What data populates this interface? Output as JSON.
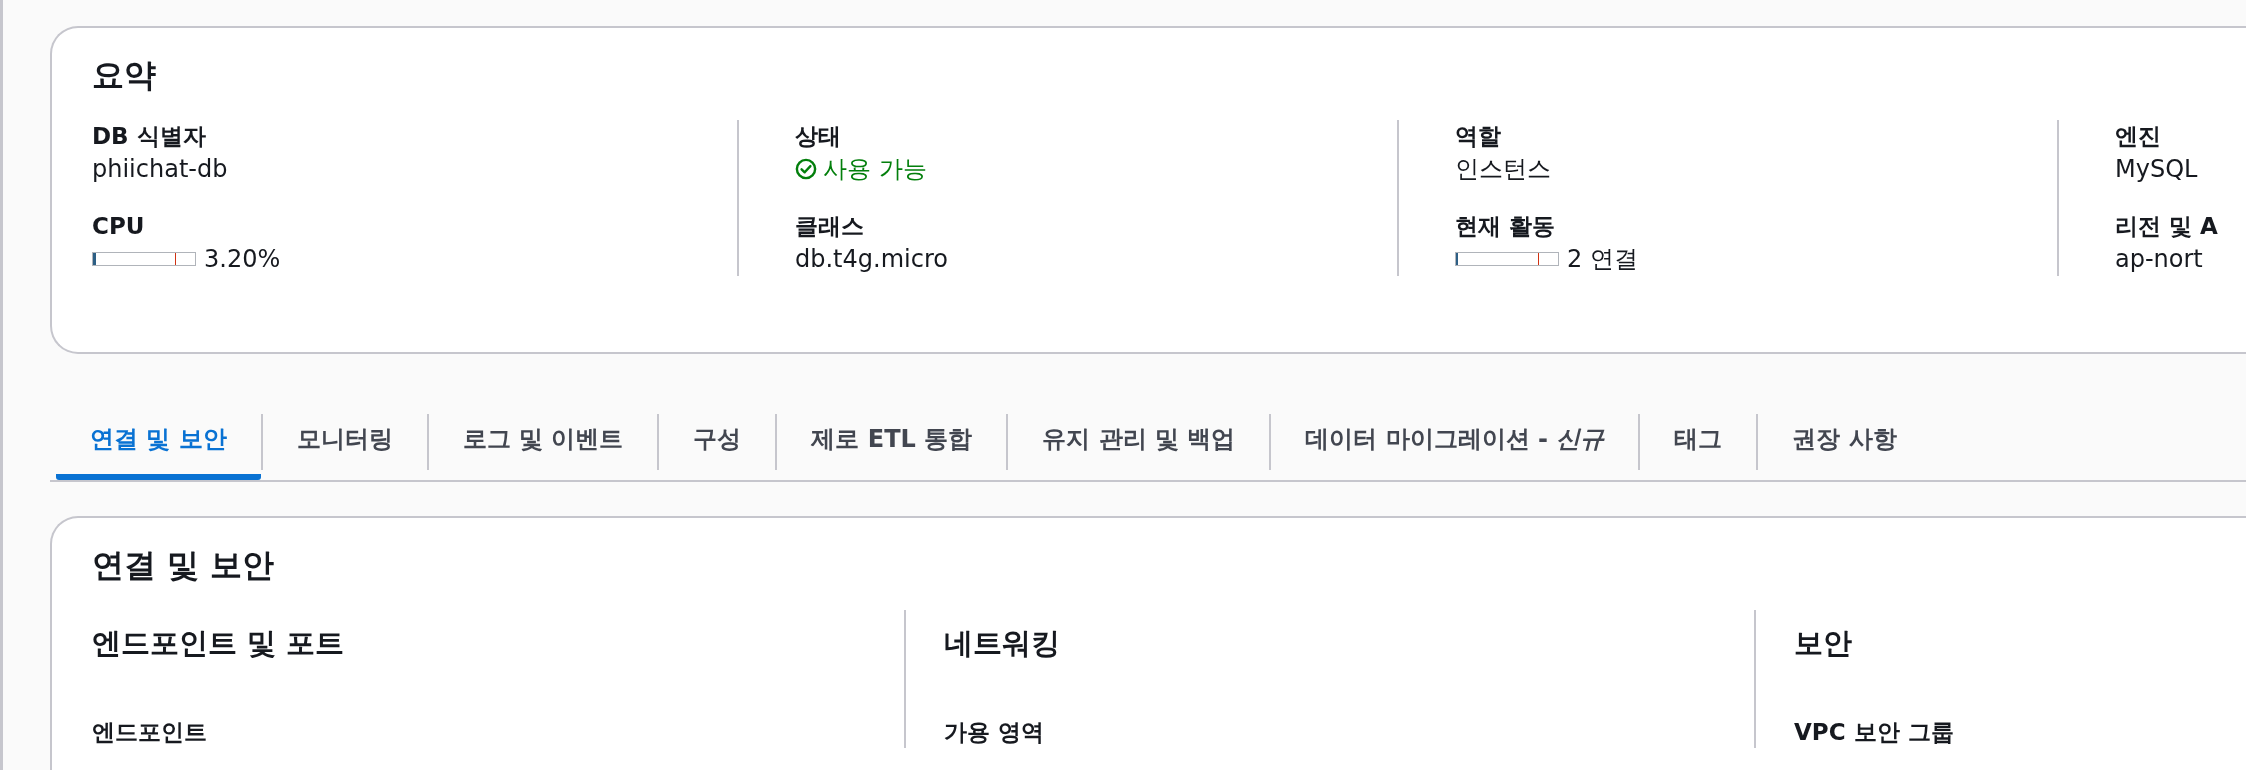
{
  "summary": {
    "title": "요약",
    "columns": [
      {
        "fields": [
          {
            "kind": "text",
            "label": "DB 식별자",
            "value": "phiichat-db"
          },
          {
            "kind": "meter",
            "label": "CPU",
            "level": 0.032,
            "reading": "3.20%"
          }
        ]
      },
      {
        "fields": [
          {
            "kind": "status",
            "label": "상태",
            "value": "사용 가능"
          },
          {
            "kind": "text",
            "label": "클래스",
            "value": "db.t4g.micro"
          }
        ]
      },
      {
        "fields": [
          {
            "kind": "text",
            "label": "역할",
            "value": "인스턴스"
          },
          {
            "kind": "meter",
            "label": "현재 활동",
            "level": 0.02,
            "reading": "2 연결"
          }
        ]
      },
      {
        "fields": [
          {
            "kind": "text",
            "label": "엔진",
            "value": "MySQL"
          },
          {
            "kind": "text",
            "label": "리전 및 A",
            "value": "ap-nort"
          }
        ]
      }
    ]
  },
  "tabs": [
    {
      "label": "연결 및 보안",
      "selected": true
    },
    {
      "label": "모니터링",
      "selected": false
    },
    {
      "label": "로그 및 이벤트",
      "selected": false
    },
    {
      "label": "구성",
      "selected": false
    },
    {
      "label": "제로 ETL 통합",
      "selected": false
    },
    {
      "label": "유지 관리 및 백업",
      "selected": false
    },
    {
      "label": "데이터 마이그레이션 - *신규*",
      "selected": false
    },
    {
      "label": "태그",
      "selected": false
    },
    {
      "label": "권장 사항",
      "selected": false
    }
  ],
  "connectivity": {
    "title": "연결 및 보안",
    "columns": [
      {
        "heading": "엔드포인트 및 포트",
        "label": "엔드포인트"
      },
      {
        "heading": "네트워킹",
        "label": "가용 영역"
      },
      {
        "heading": "보안",
        "label": "VPC 보안 그룹"
      }
    ]
  }
}
